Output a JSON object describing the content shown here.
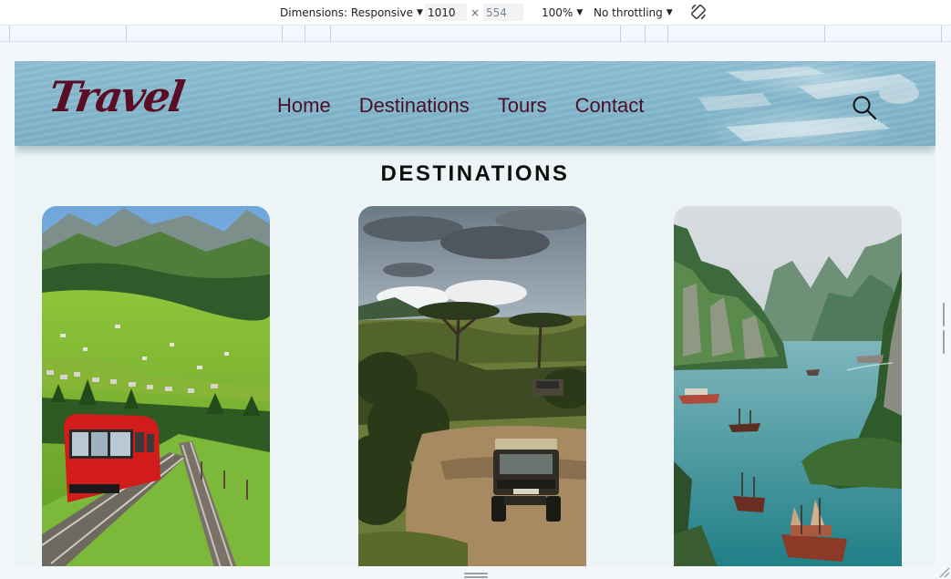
{
  "devtools": {
    "dimensions_label": "Dimensions: Responsive",
    "width_value": "1010",
    "times_symbol": "×",
    "height_value": "554",
    "zoom_label": "100%",
    "throttling_label": "No throttling",
    "icons": {
      "rotate": "rotate-icon",
      "caret": "chevron-down-icon"
    }
  },
  "site": {
    "logo_text": "Travel",
    "nav": [
      {
        "label": "Home"
      },
      {
        "label": "Destinations"
      },
      {
        "label": "Tours"
      },
      {
        "label": "Contact"
      }
    ],
    "search_icon": "search-icon",
    "section_title": "DESTINATIONS",
    "cards": [
      {
        "image": "swiss-alps-red-mountain-train"
      },
      {
        "image": "african-savanna-safari-jeep"
      },
      {
        "image": "halong-bay-boats-limestone-cliffs"
      }
    ],
    "colors": {
      "brand": "#5a0d25",
      "header": "#86b8cd",
      "page_bg": "#edf4f6"
    }
  }
}
